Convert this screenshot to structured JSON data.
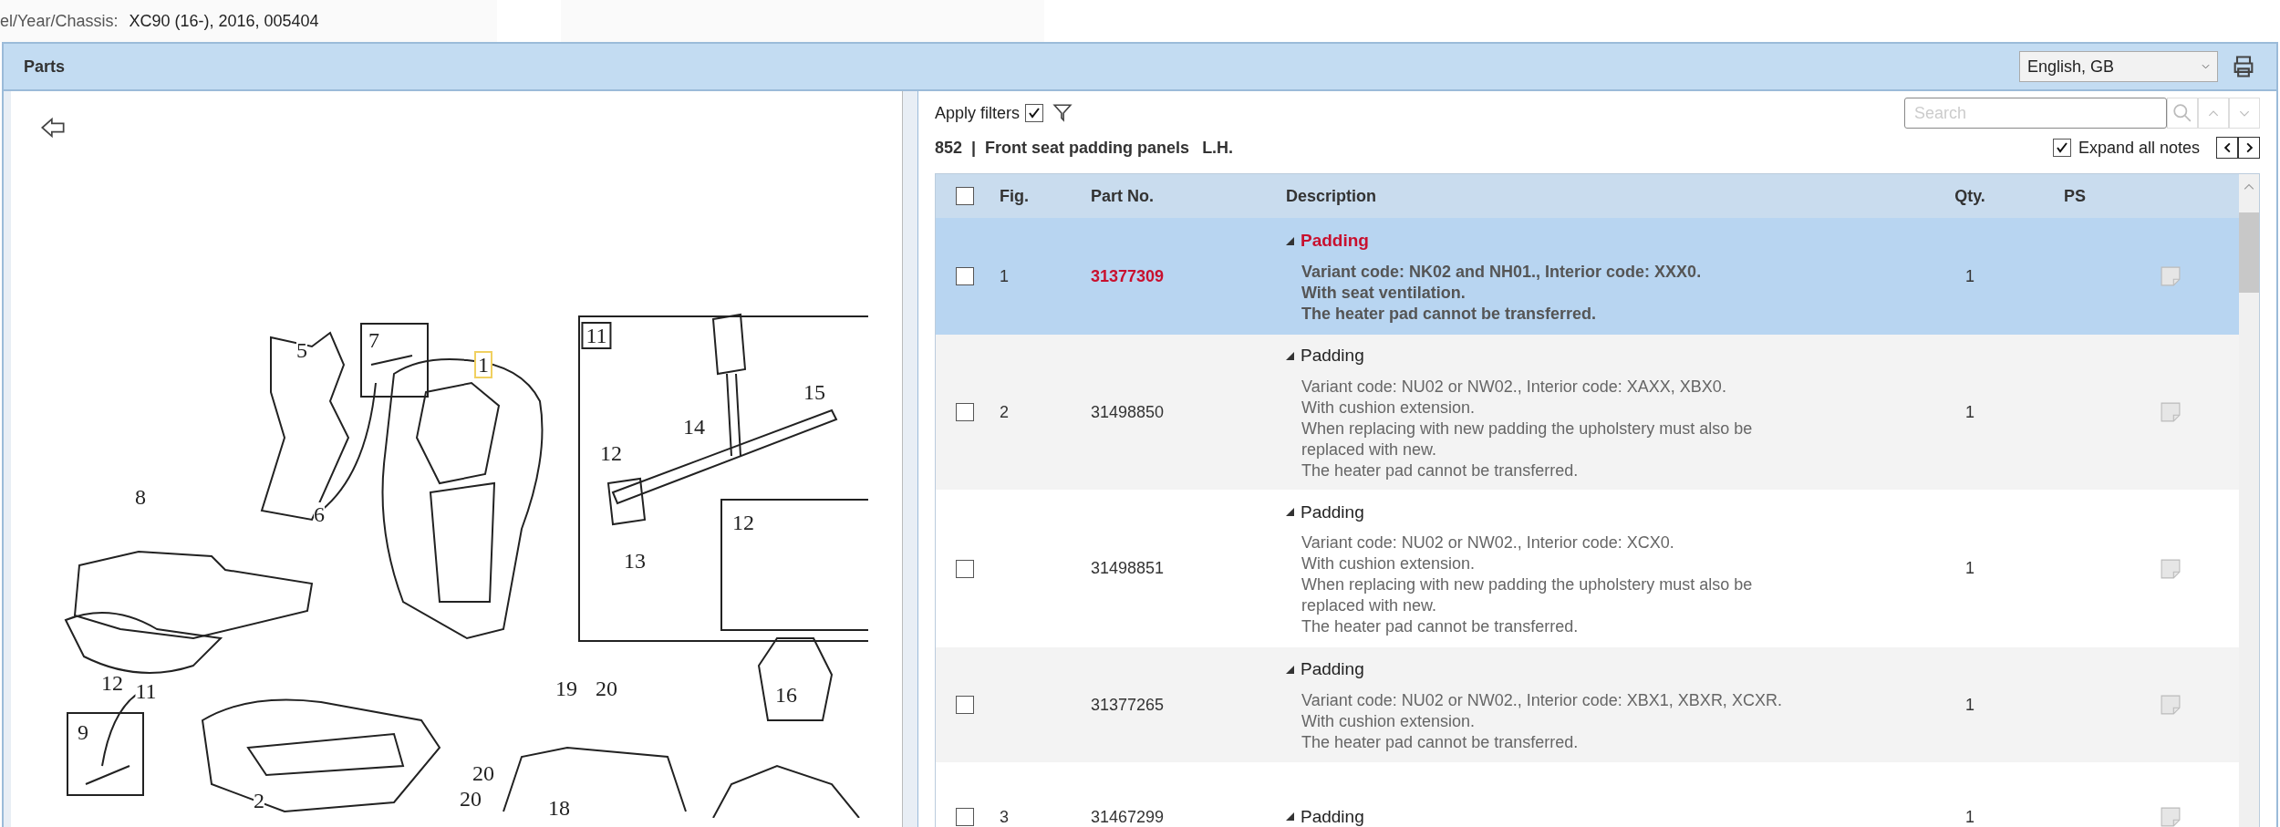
{
  "vehicle": {
    "label": "el/Year/Chassis:",
    "value": "XC90 (16-), 2016, 005404"
  },
  "parts_panel": {
    "title": "Parts",
    "language": "English, GB"
  },
  "diagram": {
    "callouts": [
      {
        "label": "5",
        "kind": "plain"
      },
      {
        "label": "7",
        "kind": "plain"
      },
      {
        "label": "1",
        "kind": "highlighted"
      },
      {
        "label": "11",
        "kind": "framed"
      },
      {
        "label": "15",
        "kind": "plain"
      },
      {
        "label": "14",
        "kind": "plain"
      },
      {
        "label": "12",
        "kind": "plain"
      },
      {
        "label": "13",
        "kind": "plain"
      },
      {
        "label": "12",
        "kind": "plain"
      },
      {
        "label": "8",
        "kind": "plain"
      },
      {
        "label": "6",
        "kind": "plain"
      },
      {
        "label": "12",
        "kind": "plain"
      },
      {
        "label": "11",
        "kind": "plain"
      },
      {
        "label": "9",
        "kind": "plain"
      },
      {
        "label": "19",
        "kind": "plain"
      },
      {
        "label": "20",
        "kind": "plain"
      },
      {
        "label": "16",
        "kind": "plain"
      },
      {
        "label": "20",
        "kind": "plain"
      },
      {
        "label": "2",
        "kind": "plain"
      },
      {
        "label": "20",
        "kind": "plain"
      },
      {
        "label": "18",
        "kind": "plain"
      }
    ]
  },
  "list": {
    "apply_filters": {
      "label": "Apply filters",
      "checked": true
    },
    "section_number": "852",
    "separator": "|",
    "section_title": "Front seat padding panels",
    "section_side": "L.H.",
    "search": {
      "placeholder": "Search"
    },
    "expand_notes": {
      "label": "Expand all notes",
      "checked": true
    },
    "columns": [
      "Fig.",
      "Part No.",
      "Description",
      "Qty.",
      "PS"
    ],
    "select_all": {
      "checked": false
    },
    "rows": [
      {
        "selected": true,
        "checked": false,
        "expanded": true,
        "fig": "1",
        "part_no": "31377309",
        "title": "Padding",
        "qty": "1",
        "notes": [
          "Variant code: NK02 and NH01., Interior code: XXX0.",
          "With seat ventilation.",
          "The heater pad cannot be transferred."
        ]
      },
      {
        "selected": false,
        "checked": false,
        "expanded": true,
        "fig": "2",
        "part_no": "31498850",
        "title": "Padding",
        "qty": "1",
        "notes": [
          "Variant code: NU02 or NW02., Interior code: XAXX, XBX0.",
          "With cushion extension.",
          "When replacing with new padding the upholstery must also be replaced with new.",
          "The heater pad cannot be transferred."
        ]
      },
      {
        "selected": false,
        "checked": false,
        "expanded": true,
        "part_no": "31498851",
        "title": "Padding",
        "qty": "1",
        "notes": [
          "Variant code: NU02 or NW02., Interior code: XCX0.",
          "With cushion extension.",
          "When replacing with new padding the upholstery must also be replaced with new.",
          "The heater pad cannot be transferred."
        ]
      },
      {
        "selected": false,
        "checked": false,
        "expanded": true,
        "part_no": "31377265",
        "title": "Padding",
        "qty": "1",
        "notes": [
          "Variant code: NU02 or NW02., Interior code: XBX1, XBXR, XCXR.",
          "With cushion extension.",
          "The heater pad cannot be transferred."
        ]
      },
      {
        "selected": false,
        "checked": false,
        "expanded": true,
        "fig": "3",
        "part_no": "31467299",
        "title": "Padding",
        "qty": "1"
      }
    ]
  }
}
